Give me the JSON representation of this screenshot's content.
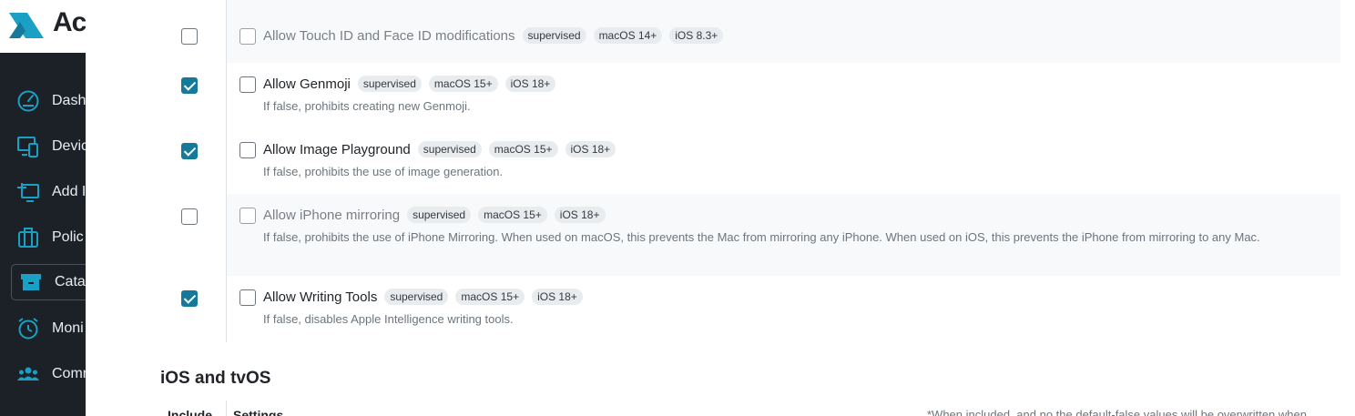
{
  "brand": {
    "logo_text": "Ac",
    "accent": "#157a99"
  },
  "sidebar": {
    "items": [
      {
        "label": "Dash",
        "icon": "gauge-icon"
      },
      {
        "label": "Devic",
        "icon": "devices-icon"
      },
      {
        "label": "Add I",
        "icon": "add-device-icon"
      },
      {
        "label": "Polic",
        "icon": "briefcase-icon"
      },
      {
        "label": "Catal",
        "icon": "archive-icon",
        "active": true
      },
      {
        "label": "Moni",
        "icon": "alarm-clock-icon"
      },
      {
        "label": "Comm",
        "icon": "users-icon"
      }
    ]
  },
  "settings": [
    {
      "label": "Allow Touch ID and Face ID modifications",
      "badges": [
        "supervised",
        "macOS 14+",
        "iOS 8.3+"
      ],
      "description": "",
      "included": false,
      "enabled": false
    },
    {
      "label": "Allow Genmoji",
      "badges": [
        "supervised",
        "macOS 15+",
        "iOS 18+"
      ],
      "description": "If false, prohibits creating new Genmoji.",
      "included": true,
      "enabled": true
    },
    {
      "label": "Allow Image Playground",
      "badges": [
        "supervised",
        "macOS 15+",
        "iOS 18+"
      ],
      "description": "If false, prohibits the use of image generation.",
      "included": true,
      "enabled": true
    },
    {
      "label": "Allow iPhone mirroring",
      "badges": [
        "supervised",
        "macOS 15+",
        "iOS 18+"
      ],
      "description": "If false, prohibits the use of iPhone Mirroring. When used on macOS, this prevents the Mac from mirroring any iPhone. When used on iOS, this prevents the iPhone from mirroring to any Mac.",
      "included": false,
      "enabled": false
    },
    {
      "label": "Allow Writing Tools",
      "badges": [
        "supervised",
        "macOS 15+",
        "iOS 18+"
      ],
      "description": "If false, disables Apple Intelligence writing tools.",
      "included": true,
      "enabled": true
    }
  ],
  "next_section": {
    "title": "iOS and tvOS",
    "col_include": "Include",
    "col_settings": "Settings",
    "note": "*When included, and no the default-false values will be overwritten when"
  }
}
